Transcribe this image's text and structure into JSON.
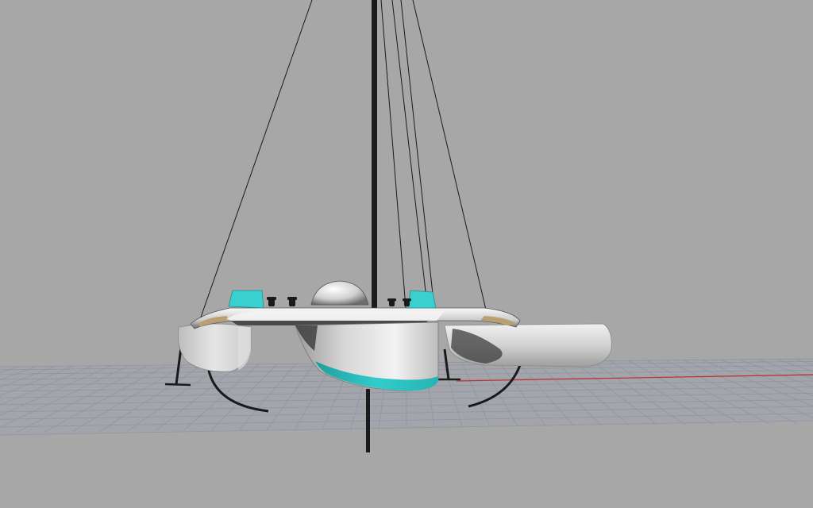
{
  "viewport": {
    "background_color": "#a7a7a7",
    "grid_color": "#8e95a3",
    "axis_x_color": "#c03030"
  },
  "model": {
    "hull_color": "#e8e8e8",
    "accent_color": "#2ec4c4",
    "deck_color": "#b8a070",
    "rig_color": "#1a1a1a",
    "icons": [
      "perspective-grid",
      "trimaran-model",
      "mast",
      "rigging-stays",
      "float-hull",
      "hydrofoil",
      "cockpit-dome",
      "winch"
    ]
  }
}
